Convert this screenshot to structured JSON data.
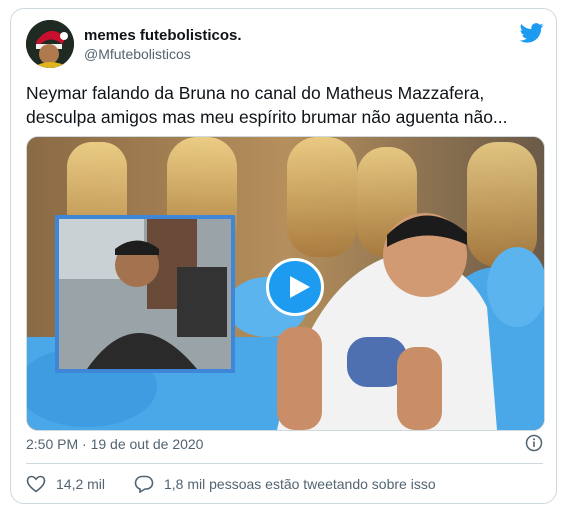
{
  "author": {
    "name": "memes futebolisticos.",
    "handle": "@Mfutebolisticos"
  },
  "tweet": {
    "lines": [
      "Neymar falando da Bruna no canal do Matheus Mazzafera,",
      "desculpa amigos mas meu espírito brumar não aguenta não..."
    ]
  },
  "meta": {
    "timestamp": "2:50 PM · 19 de out de 2020"
  },
  "actions": {
    "likes": "14,2 mil",
    "replies": "1,8 mil pessoas estão tweetando sobre isso"
  },
  "colors": {
    "brand": "#1d9bf0",
    "secondary_text": "#536471",
    "border": "#cfd9de"
  },
  "icons": [
    "twitter-bird-icon",
    "play-icon",
    "info-icon",
    "heart-icon",
    "reply-icon"
  ]
}
